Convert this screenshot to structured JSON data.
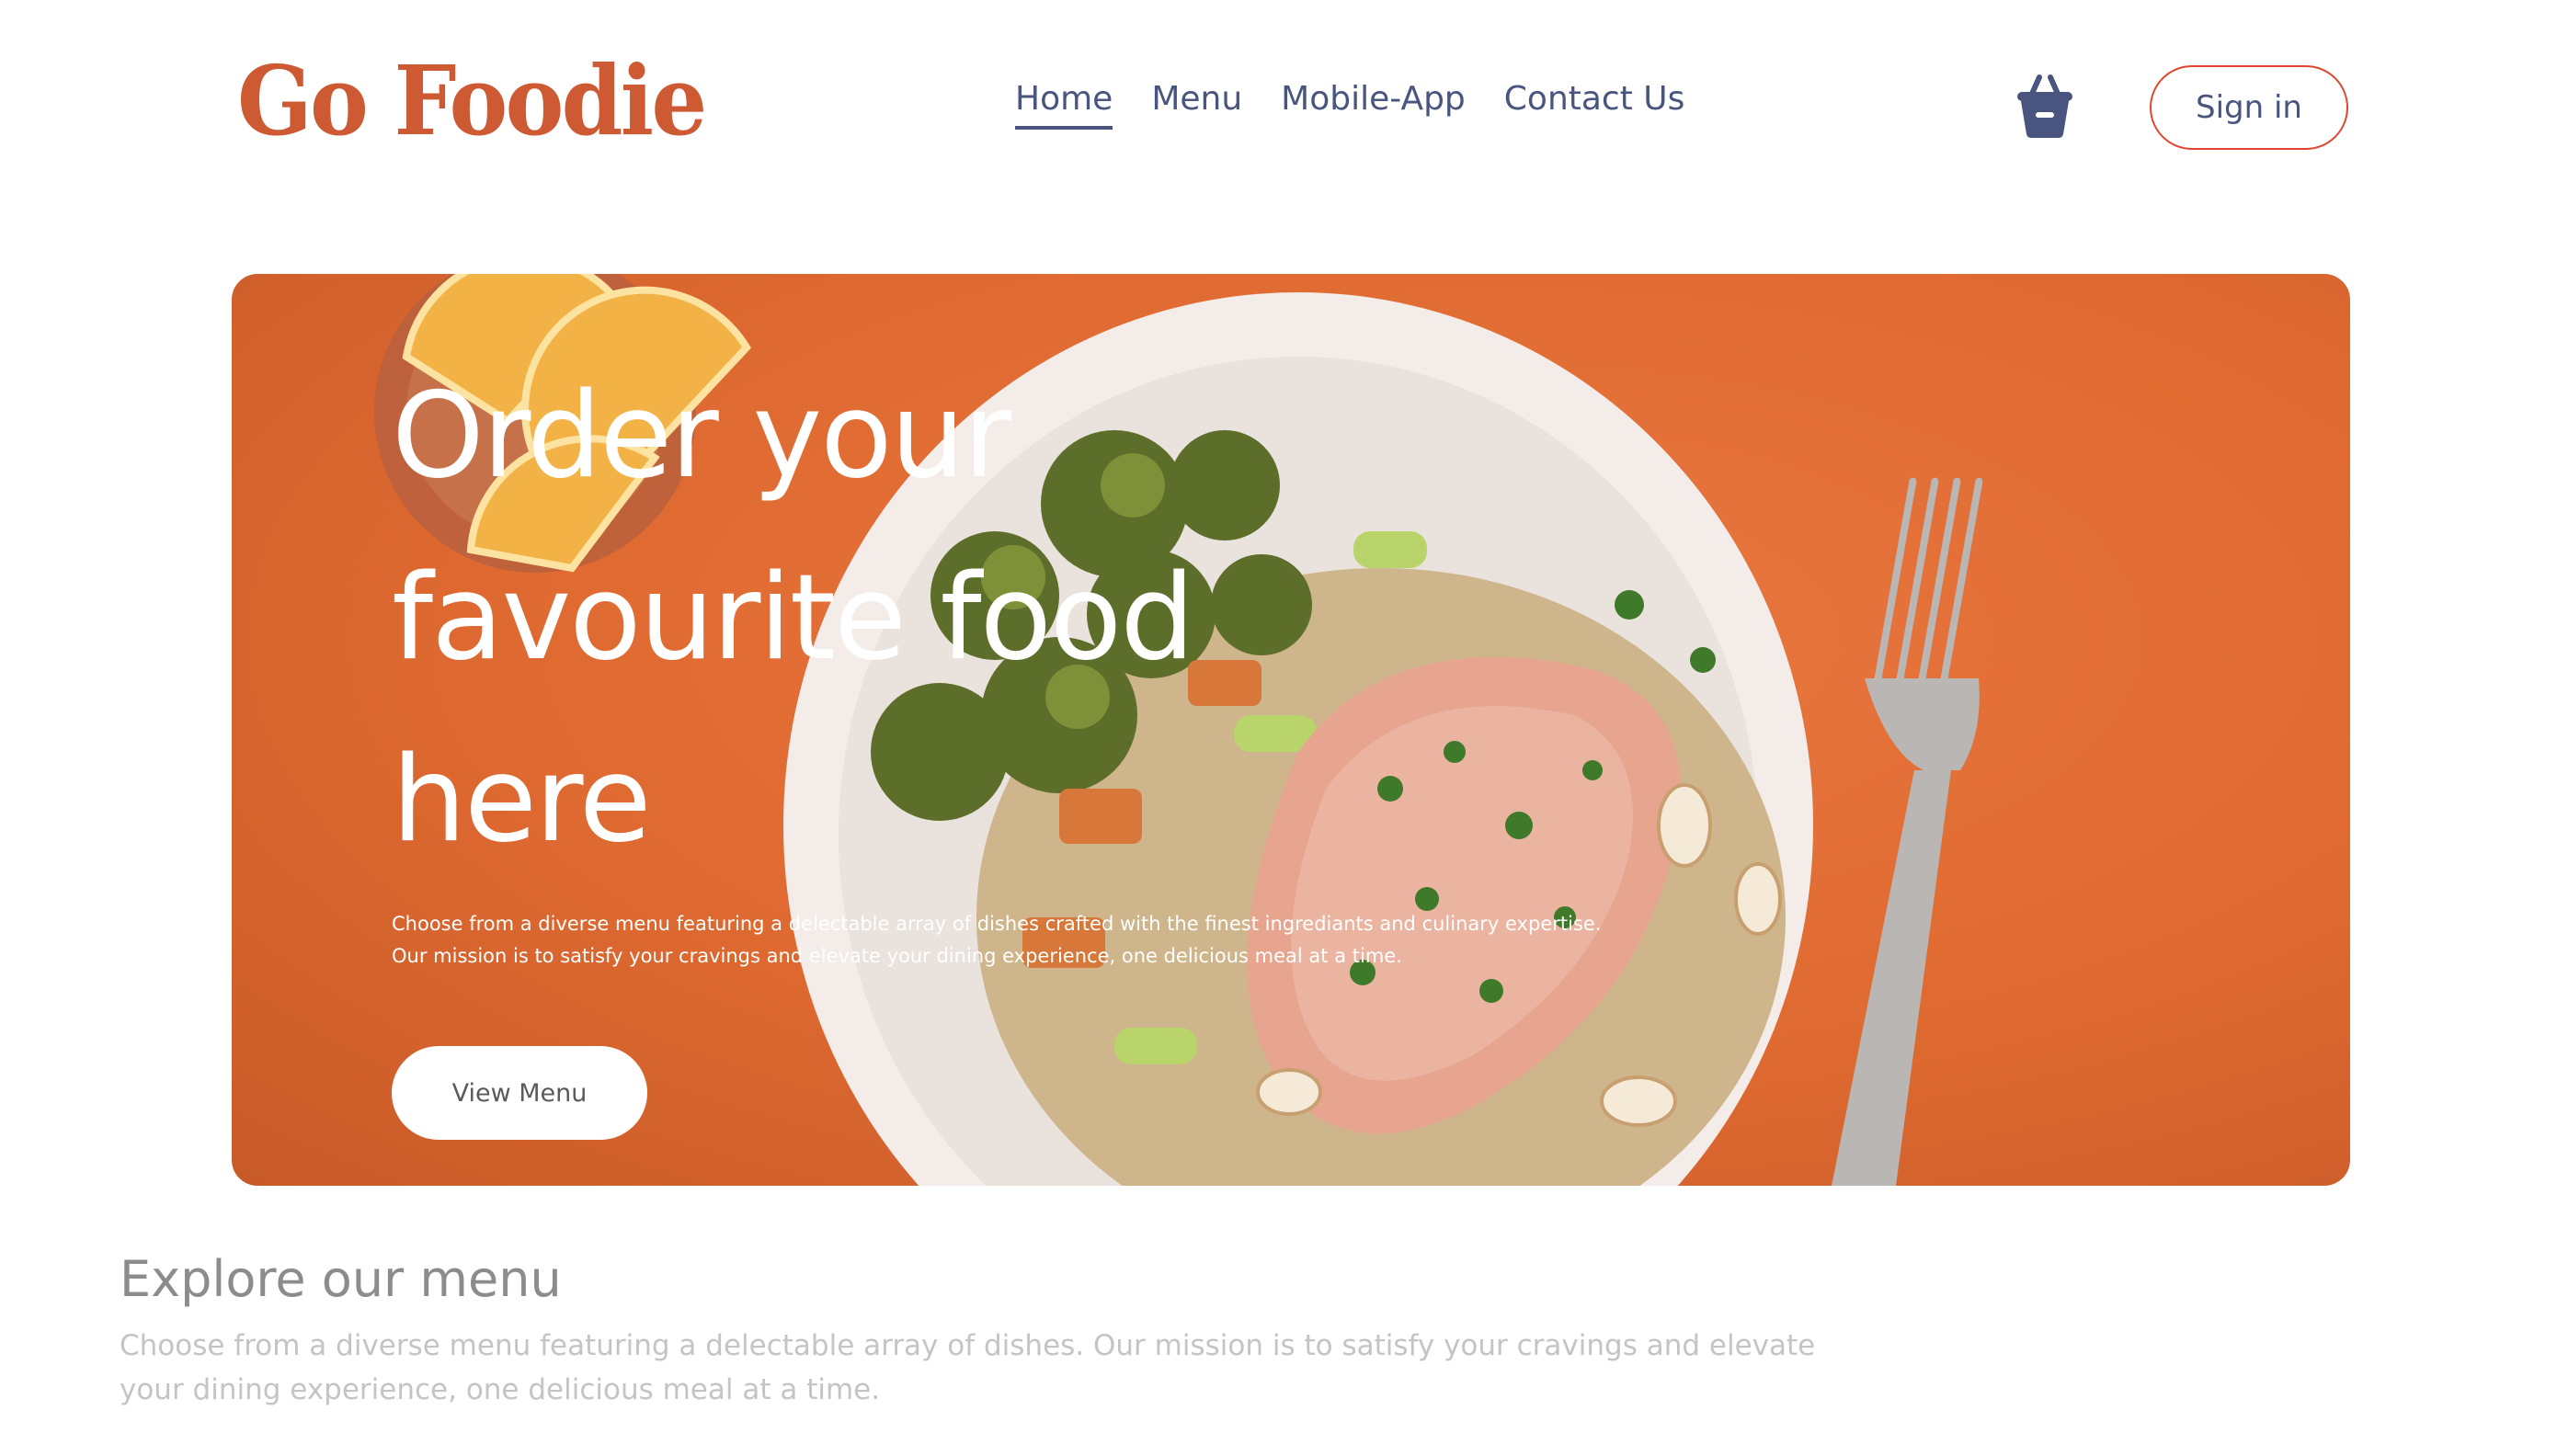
{
  "header": {
    "logo": "Go Foodie",
    "nav": [
      {
        "label": "Home",
        "active": true
      },
      {
        "label": "Menu",
        "active": false
      },
      {
        "label": "Mobile-App",
        "active": false
      },
      {
        "label": "Contact Us",
        "active": false
      }
    ],
    "basket_icon": "basket-icon",
    "sign_in_label": "Sign in"
  },
  "hero": {
    "title_line1": "Order your",
    "title_line2": "favourite food",
    "title_line3": "here",
    "description": "Choose from a diverse menu featuring a delectable array of dishes crafted with the finest ingrediants and culinary expertise. Our mission is to satisfy your cravings and elevate your dining experience, one delicious meal at a time.",
    "view_menu_label": "View Menu"
  },
  "explore": {
    "title": "Explore our menu",
    "description": "Choose from a diverse menu featuring a delectable array of dishes. Our mission is to satisfy your cravings and elevate your dining experience, one delicious meal at a time."
  },
  "colors": {
    "brand": "#cd5a33",
    "nav_text": "#49557e",
    "hero_bg": "#df6a31",
    "signin_border": "#e0452e"
  }
}
